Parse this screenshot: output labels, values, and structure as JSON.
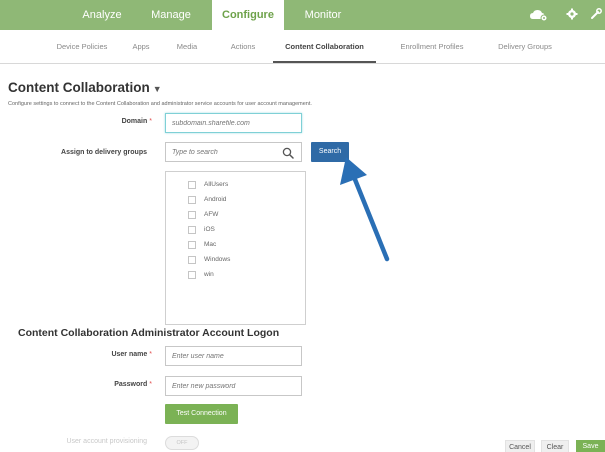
{
  "nav": {
    "items": [
      {
        "label": "Analyze",
        "active": false
      },
      {
        "label": "Manage",
        "active": false
      },
      {
        "label": "Configure",
        "active": true
      },
      {
        "label": "Monitor",
        "active": false
      }
    ],
    "icons": [
      "cloud-settings-icon",
      "gear-icon",
      "wrench-icon"
    ]
  },
  "subnav": {
    "items": [
      {
        "label": "Device Policies",
        "active": false
      },
      {
        "label": "Apps",
        "active": false
      },
      {
        "label": "Media",
        "active": false
      },
      {
        "label": "Actions",
        "active": false
      },
      {
        "label": "Content Collaboration",
        "active": true
      },
      {
        "label": "Enrollment Profiles",
        "active": false
      },
      {
        "label": "Delivery Groups",
        "active": false
      }
    ]
  },
  "page": {
    "title": "Content Collaboration",
    "description": "Configure settings to connect to the Content Collaboration and administrator service accounts for user account management."
  },
  "form": {
    "domain_label": "Domain",
    "domain_placeholder": "subdomain.sharefile.com",
    "assign_label": "Assign to delivery groups",
    "search_placeholder": "Type to search",
    "search_button": "Search",
    "groups": [
      "AllUsers",
      "Android",
      "AFW",
      "iOS",
      "Mac",
      "Windows",
      "win"
    ],
    "admin_section_title": "Content Collaboration Administrator Account Logon",
    "username_label": "User name",
    "username_placeholder": "Enter user name",
    "password_label": "Password",
    "password_placeholder": "Enter new password",
    "test_button": "Test Connection",
    "provisioning_label": "User account provisioning",
    "provisioning_state": "OFF"
  },
  "footer": {
    "cancel": "Cancel",
    "clear": "Clear",
    "save": "Save"
  },
  "colors": {
    "nav_bg": "#8fb876",
    "accent_green": "#7bb255",
    "search_blue": "#2f6aa6",
    "arrow_blue": "#2a6fb5",
    "required_red": "#e04c4c"
  }
}
